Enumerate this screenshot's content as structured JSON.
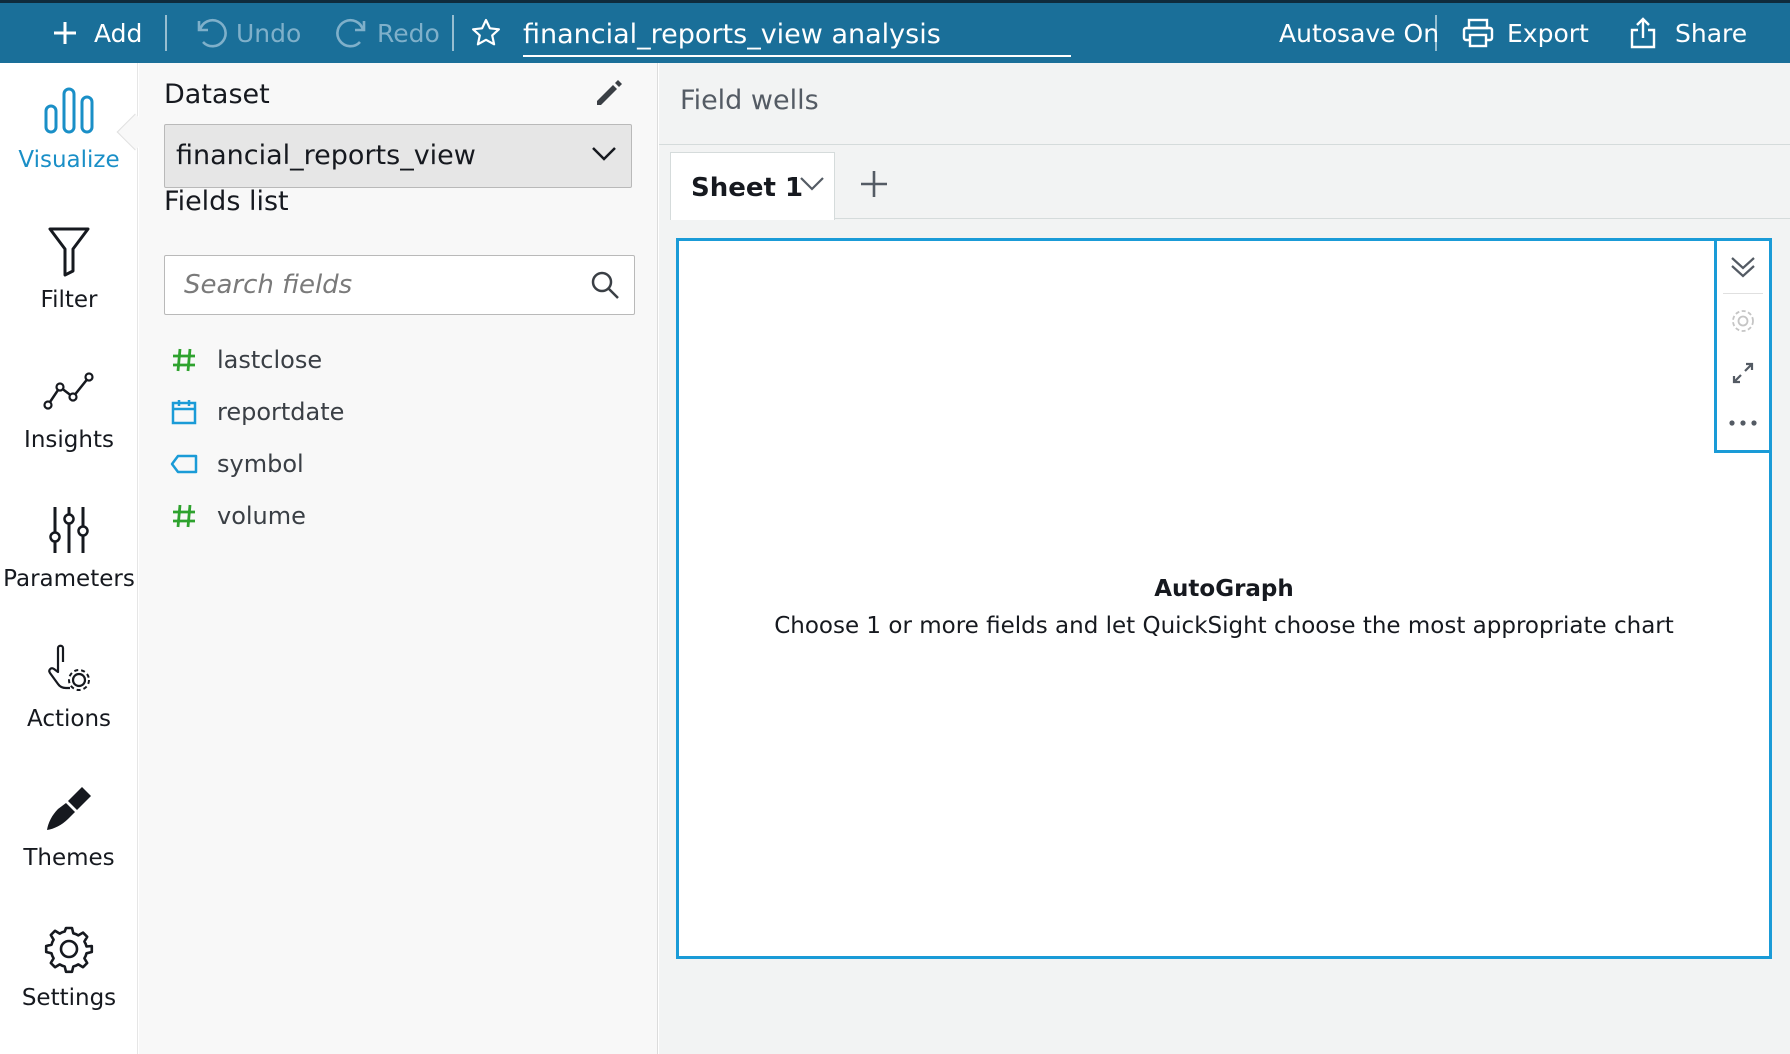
{
  "topbar": {
    "add_label": "Add",
    "undo_label": "Undo",
    "redo_label": "Redo",
    "analysis_title": "financial_reports_view analysis",
    "autosave_label": "Autosave On",
    "export_label": "Export",
    "share_label": "Share",
    "colors": {
      "background": "#1a6f99",
      "muted_text": "#7fb0ca"
    }
  },
  "rail": {
    "items": [
      {
        "label": "Visualize",
        "icon": "bar-chart-icon",
        "active": true
      },
      {
        "label": "Filter",
        "icon": "funnel-icon"
      },
      {
        "label": "Insights",
        "icon": "line-trend-icon"
      },
      {
        "label": "Parameters",
        "icon": "sliders-icon"
      },
      {
        "label": "Actions",
        "icon": "pointer-gear-icon"
      },
      {
        "label": "Themes",
        "icon": "brush-icon"
      },
      {
        "label": "Settings",
        "icon": "gear-icon"
      }
    ],
    "accent_color": "#1a8fc7"
  },
  "panel": {
    "dataset_heading": "Dataset",
    "dataset_selected": "financial_reports_view",
    "fields_heading": "Fields list",
    "search_placeholder": "Search fields",
    "fields": [
      {
        "name": "lastclose",
        "type": "measure",
        "icon": "hash-icon"
      },
      {
        "name": "reportdate",
        "type": "date",
        "icon": "calendar-icon"
      },
      {
        "name": "symbol",
        "type": "dimension",
        "icon": "tag-icon"
      },
      {
        "name": "volume",
        "type": "measure",
        "icon": "hash-icon"
      }
    ],
    "colors": {
      "measure": "#2ea22e",
      "dimension": "#1a9bd7"
    }
  },
  "main": {
    "field_wells_label": "Field wells",
    "sheet_tab_label": "Sheet 1",
    "visual": {
      "title": "AutoGraph",
      "description": "Choose 1 or more fields and let QuickSight choose the most appropriate chart",
      "border_color": "#1a9bd7",
      "menu_icons": [
        "collapse-chevrons-icon",
        "gear-icon",
        "expand-icon",
        "more-icon"
      ]
    }
  }
}
